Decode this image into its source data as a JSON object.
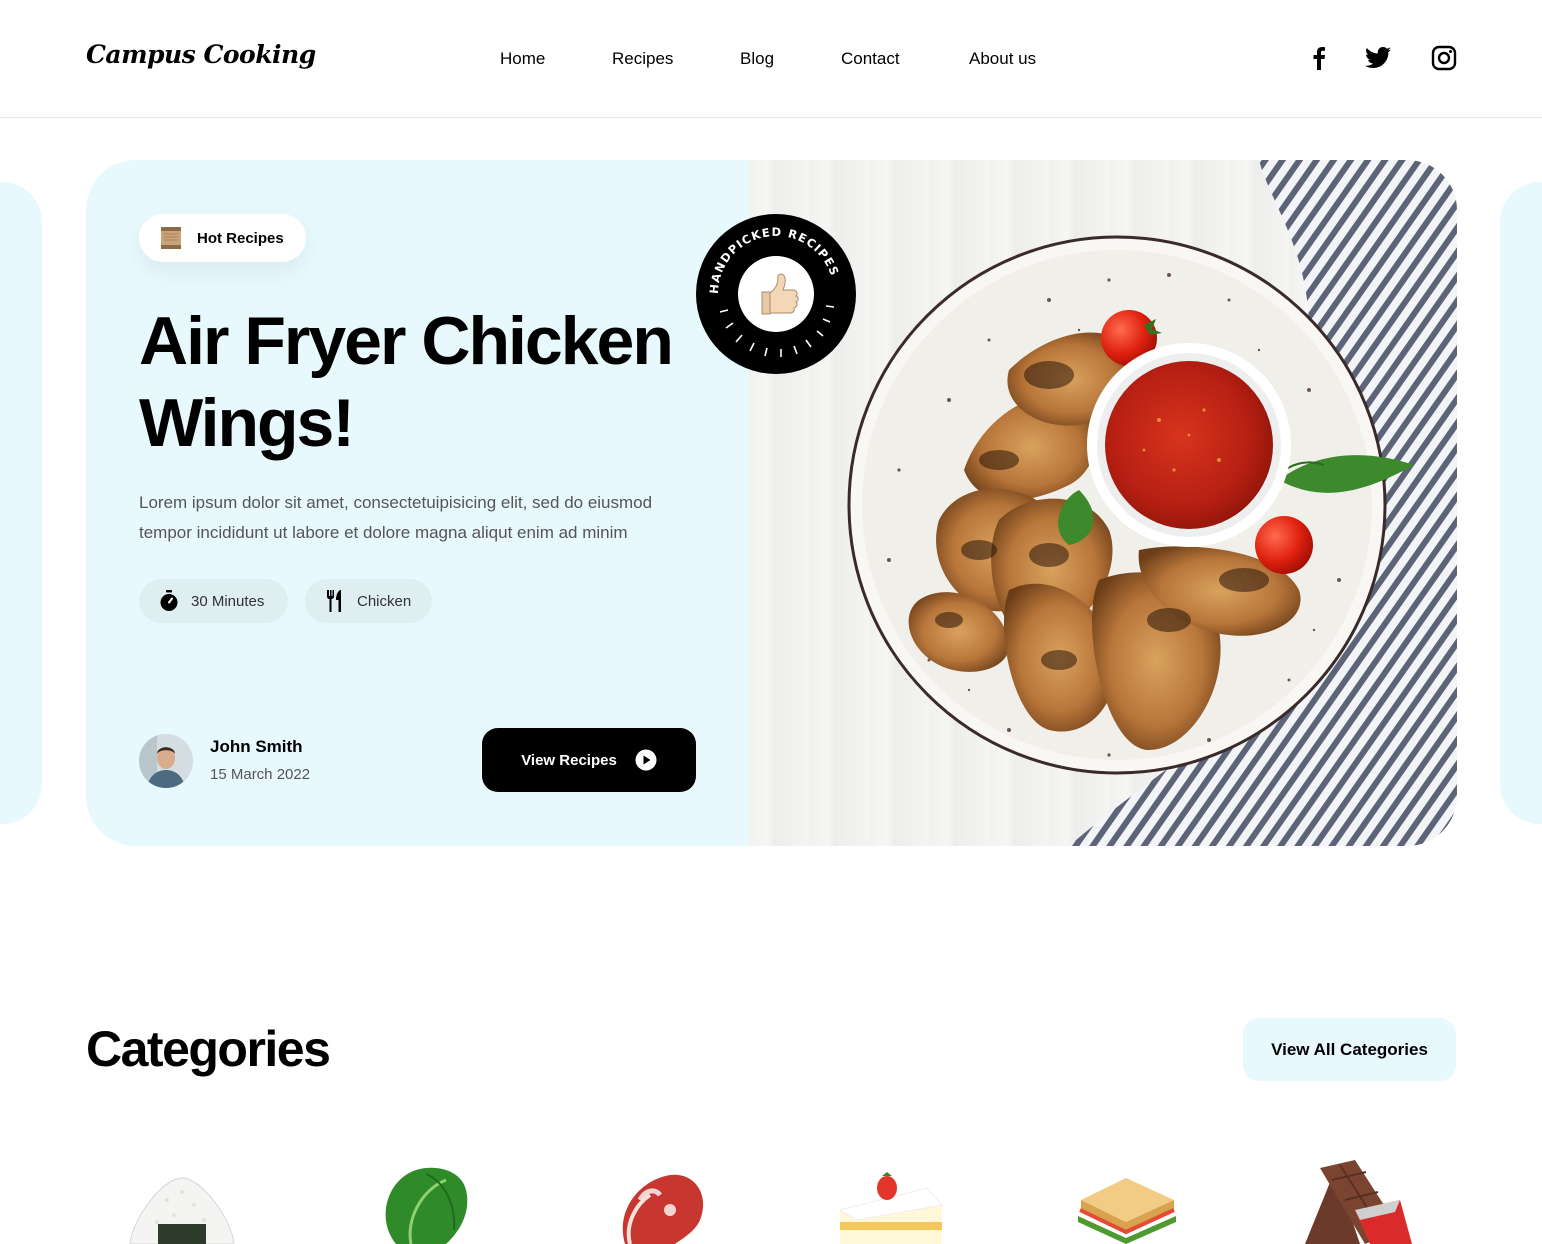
{
  "header": {
    "logo": "Campus Cooking",
    "nav": [
      "Home",
      "Recipes",
      "Blog",
      "Contact",
      "About us"
    ],
    "social": [
      "facebook-icon",
      "twitter-icon",
      "instagram-icon"
    ]
  },
  "hero": {
    "tag": "Hot Recipes",
    "title_line1": "Air Fryer Chicken",
    "title_line2": "Wings!",
    "description": "Lorem ipsum dolor sit amet, consectetuipisicing elit, sed do eiusmod tempor incididunt ut labore et dolore magna aliqut enim ad minim",
    "chips": [
      {
        "label": "30 Minutes",
        "icon": "timer-icon"
      },
      {
        "label": "Chicken",
        "icon": "fork-knife-icon"
      }
    ],
    "author": {
      "name": "John Smith",
      "date": "15 March 2022"
    },
    "cta": "View Recipes",
    "badge_text": "HANDPICKED RECIPES"
  },
  "categories": {
    "title": "Categories",
    "view_all": "View All Categories",
    "items": [
      "rice-ball-icon",
      "leafy-green-icon",
      "steak-icon",
      "cake-icon",
      "sandwich-icon",
      "chocolate-bar-icon"
    ]
  },
  "colors": {
    "accent_bg": "#e7f9fd",
    "primary": "#000000"
  }
}
